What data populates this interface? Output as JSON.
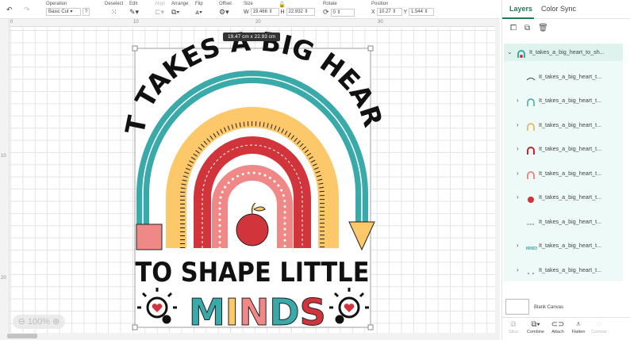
{
  "toolbar": {
    "undo_icon": "undo-icon",
    "redo_icon": "redo-icon",
    "operation": {
      "label": "Operation",
      "value": "Basic Cut",
      "help": "?"
    },
    "deselect": "Deselect",
    "edit": "Edit",
    "align": "Align",
    "arrange": "Arrange",
    "flip": "Flip",
    "offset": "Offset",
    "size": {
      "label": "Size",
      "w_label": "W",
      "w": "19.466",
      "h_label": "H",
      "h": "22.932"
    },
    "rotate": {
      "label": "Rotate",
      "value": "0"
    },
    "position": {
      "label": "Position",
      "x_label": "X",
      "x": "10.27",
      "y_label": "Y",
      "y": "1.544"
    }
  },
  "rulers": {
    "top": [
      "0",
      "10",
      "20",
      "30"
    ],
    "left": [
      "10",
      "20"
    ]
  },
  "canvas": {
    "size_tooltip": "19.47  cm x 22.93  cm",
    "zoom": "100%",
    "artwork": {
      "line1": "IT TAKES A BIG HEART",
      "line2": "TO SHAPE LITTLE",
      "line3": [
        "M",
        "I",
        "N",
        "D",
        "S"
      ]
    }
  },
  "colors": {
    "accent": "#1f7a55",
    "teal": "#3aa9a9",
    "yellow": "#fcc86a",
    "red": "#d1343a",
    "pink": "#f18888",
    "layers_bg": "#eefaf7"
  },
  "panel": {
    "tabs": [
      "Layers",
      "Color Sync"
    ],
    "layers": [
      {
        "name": "It_takes_a_big_heart_to_sh...",
        "expanded": true
      },
      {
        "name": "It_takes_a_big_heart_t..."
      },
      {
        "name": "It_takes_a_big_heart_t..."
      },
      {
        "name": "It_takes_a_big_heart_t..."
      },
      {
        "name": "It_takes_a_big_heart_t..."
      },
      {
        "name": "It_takes_a_big_heart_t..."
      },
      {
        "name": "It_takes_a_big_heart_t..."
      },
      {
        "name": "It_takes_a_big_heart_t..."
      },
      {
        "name": "It_takes_a_big_heart_t..."
      },
      {
        "name": "It_takes_a_big_heart_t..."
      }
    ],
    "blank_canvas": "Blank Canvas",
    "bottom": [
      "Slice",
      "Combine",
      "Attach",
      "Flatten",
      "Contour"
    ]
  }
}
